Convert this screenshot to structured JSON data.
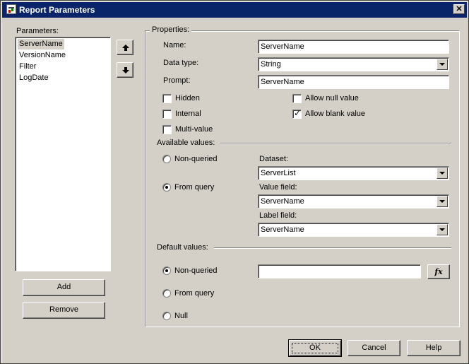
{
  "window": {
    "title": "Report Parameters",
    "close_label": "✕"
  },
  "parameters": {
    "label": "Parameters:",
    "items": [
      "ServerName",
      "VersionName",
      "Filter",
      "LogDate"
    ],
    "selected_index": 0,
    "add_label": "Add",
    "remove_label": "Remove"
  },
  "properties": {
    "group_label": "Properties:",
    "name": {
      "label": "Name:",
      "value": "ServerName"
    },
    "data_type": {
      "label": "Data type:",
      "value": "String"
    },
    "prompt": {
      "label": "Prompt:",
      "value": "ServerName"
    },
    "hidden": {
      "label": "Hidden",
      "checked": false
    },
    "internal": {
      "label": "Internal",
      "checked": false
    },
    "multi_value": {
      "label": "Multi-value",
      "checked": false
    },
    "allow_null": {
      "label": "Allow null value",
      "checked": false
    },
    "allow_blank": {
      "label": "Allow blank value",
      "checked": true
    }
  },
  "available_values": {
    "label": "Available values:",
    "non_queried_label": "Non-queried",
    "from_query_label": "From query",
    "selected": "From query",
    "dataset": {
      "label": "Dataset:",
      "value": "ServerList"
    },
    "value_field": {
      "label": "Value field:",
      "value": "ServerName"
    },
    "label_field": {
      "label": "Label field:",
      "value": "ServerName"
    }
  },
  "default_values": {
    "label": "Default values:",
    "non_queried_label": "Non-queried",
    "from_query_label": "From query",
    "null_label": "Null",
    "selected": "Non-queried",
    "expression_value": "",
    "fx_label": "fx"
  },
  "footer": {
    "ok_label": "OK",
    "cancel_label": "Cancel",
    "help_label": "Help"
  }
}
